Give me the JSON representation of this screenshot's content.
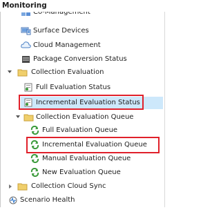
{
  "header": {
    "title": "Monitoring"
  },
  "tree": {
    "items": [
      {
        "label": "Co-Management",
        "icon": "grid-icon"
      },
      {
        "label": "Surface Devices",
        "icon": "devices-icon"
      },
      {
        "label": "Cloud Management",
        "icon": "cloud-icon"
      },
      {
        "label": "Package Conversion Status",
        "icon": "package-icon"
      },
      {
        "label": "Collection Evaluation",
        "icon": "folder-icon"
      },
      {
        "label": "Full Evaluation Status",
        "icon": "status-doc-icon"
      },
      {
        "label": "Incremental Evaluation Status",
        "icon": "status-doc-icon"
      },
      {
        "label": "Collection Evaluation Queue",
        "icon": "folder-icon"
      },
      {
        "label": "Full Evaluation Queue",
        "icon": "refresh-icon"
      },
      {
        "label": "Incremental Evaluation Queue",
        "icon": "refresh-icon"
      },
      {
        "label": "Manual Evaluation Queue",
        "icon": "refresh-icon"
      },
      {
        "label": "New Evaluation Queue",
        "icon": "refresh-icon"
      },
      {
        "label": "Collection Cloud Sync",
        "icon": "folder-icon"
      },
      {
        "label": "Scenario Health",
        "icon": "health-icon"
      }
    ]
  },
  "colors": {
    "highlight": "#e0202a",
    "folder": "#e8c25a",
    "refresh": "#3a9a3a",
    "selection": "#cde8fb"
  }
}
